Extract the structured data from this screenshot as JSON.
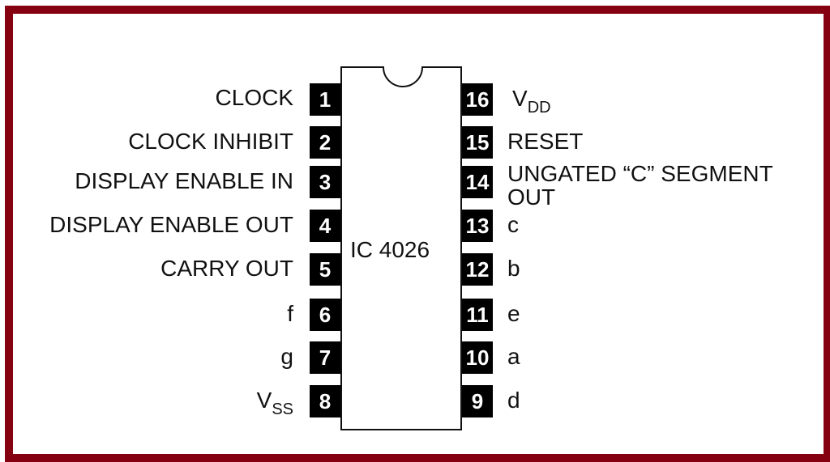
{
  "chip": {
    "name": "IC 4026"
  },
  "colors": {
    "frame": "#850010",
    "pin_fill": "#000000",
    "pin_text": "#ffffff"
  },
  "left_pins": [
    {
      "num": "1",
      "label": "CLOCK",
      "sub": ""
    },
    {
      "num": "2",
      "label": "CLOCK INHIBIT",
      "sub": ""
    },
    {
      "num": "3",
      "label": "DISPLAY ENABLE IN",
      "sub": ""
    },
    {
      "num": "4",
      "label": "DISPLAY ENABLE OUT",
      "sub": ""
    },
    {
      "num": "5",
      "label": "CARRY OUT",
      "sub": ""
    },
    {
      "num": "6",
      "label": "f",
      "sub": ""
    },
    {
      "num": "7",
      "label": "g",
      "sub": ""
    },
    {
      "num": "8",
      "label": "V",
      "sub": "SS"
    }
  ],
  "right_pins": [
    {
      "num": "16",
      "label": "V",
      "sub": "DD"
    },
    {
      "num": "15",
      "label": "RESET",
      "sub": ""
    },
    {
      "num": "14",
      "label": "UNGATED “C” SEGMENT",
      "label2": "OUT",
      "sub": ""
    },
    {
      "num": "13",
      "label": "c",
      "sub": ""
    },
    {
      "num": "12",
      "label": "b",
      "sub": ""
    },
    {
      "num": "11",
      "label": "e",
      "sub": ""
    },
    {
      "num": "10",
      "label": "a",
      "sub": ""
    },
    {
      "num": "9",
      "label": "d",
      "sub": ""
    }
  ]
}
